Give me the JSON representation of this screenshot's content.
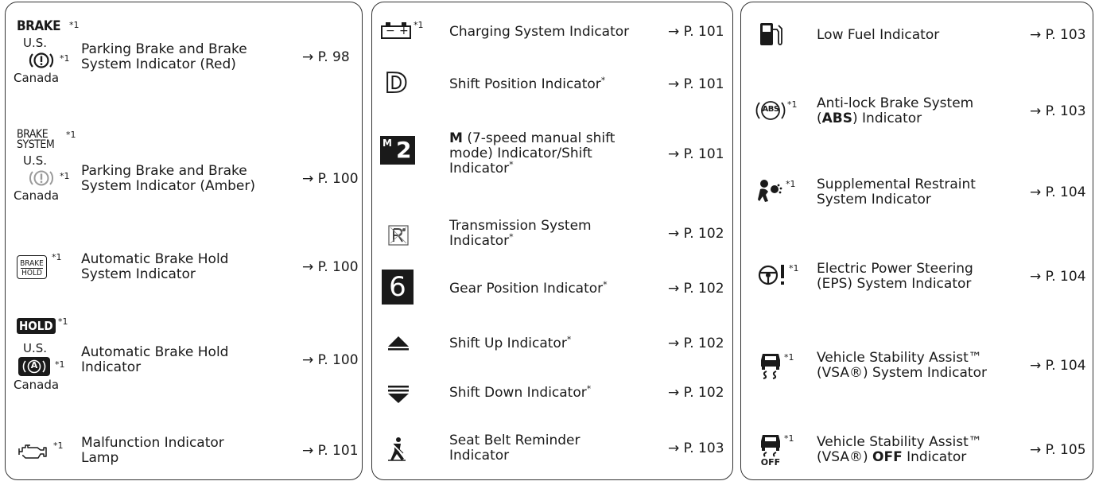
{
  "page": {
    "bg": "#ffffff",
    "border": "#333333",
    "ink": "#1a1a1a"
  },
  "col1": [
    {
      "icon_text": "BRAKE",
      "note": "*1",
      "region_us": "U.S.",
      "note2": "*1",
      "region_ca": "Canada",
      "label1": "Parking Brake and Brake",
      "label2": "System Indicator (Red)",
      "ref": "→ P. 98",
      "icon": "brake-warning-icon"
    },
    {
      "icon_text1": "BRAKE",
      "icon_text2": "SYSTEM",
      "note": "*1",
      "region_us": "U.S.",
      "note2": "*1",
      "region_ca": "Canada",
      "label1": "Parking Brake and Brake",
      "label2": "System Indicator (Amber)",
      "ref": "→ P. 100",
      "icon": "brake-system-warning-icon"
    },
    {
      "icon_text1": "BRAKE",
      "icon_text2": "HOLD",
      "note": "*1",
      "label1": "Automatic Brake Hold",
      "label2": "System Indicator",
      "ref": "→ P. 100",
      "icon": "brake-hold-system-icon"
    },
    {
      "icon_text": "HOLD",
      "note": "*1",
      "region_us": "U.S.",
      "note2": "*1",
      "region_ca": "Canada",
      "icon2_text": "A",
      "label1": "Automatic Brake Hold",
      "label2": "Indicator",
      "ref": "→ P. 100",
      "icon": "auto-brake-hold-icon"
    },
    {
      "note": "*1",
      "label1": "Malfunction Indicator",
      "label2": "Lamp",
      "ref": "→ P. 101",
      "icon": "engine-check-icon"
    }
  ],
  "col2": [
    {
      "note": "*1",
      "label1": "Charging System Indicator",
      "ref": "→ P. 101",
      "icon": "battery-icon",
      "minus": "−",
      "plus": "+"
    },
    {
      "icon_text": "D",
      "label1": "Shift Position Indicator",
      "star": "*",
      "ref": "→ P. 101",
      "icon": "shift-position-icon"
    },
    {
      "icon_text1": "M",
      "icon_text2": "2",
      "label_bold": "M",
      "label1": "(7-speed manual shift",
      "label2": "mode) Indicator/Shift",
      "label3": "Indicator",
      "star": "*",
      "ref": "→ P. 101",
      "icon": "manual-shift-icon"
    },
    {
      "label1": "Transmission System",
      "label2": "Indicator",
      "star": "*",
      "ref": "→ P. 102",
      "icon": "transmission-icon"
    },
    {
      "icon_text": "6",
      "label1": "Gear Position Indicator",
      "star": "*",
      "ref": "→ P. 102",
      "icon": "gear-position-icon"
    },
    {
      "label1": "Shift Up Indicator",
      "star": "*",
      "ref": "→ P. 102",
      "icon": "shift-up-icon"
    },
    {
      "label1": "Shift Down Indicator",
      "star": "*",
      "ref": "→ P. 102",
      "icon": "shift-down-icon"
    },
    {
      "label1": "Seat Belt Reminder",
      "label2": "Indicator",
      "ref": "→ P. 103",
      "icon": "seat-belt-icon"
    }
  ],
  "col3": [
    {
      "label1": "Low Fuel Indicator",
      "ref": "→ P. 103",
      "icon": "fuel-icon"
    },
    {
      "note": "*1",
      "icon_text": "ABS",
      "label1": "Anti-lock Brake System",
      "label2_bold": "ABS",
      "label2_rest": ") Indicator",
      "label2_open": "(",
      "ref": "→ P. 103",
      "icon": "abs-icon"
    },
    {
      "note": "*1",
      "label1": "Supplemental Restraint",
      "label2": "System Indicator",
      "ref": "→ P. 104",
      "icon": "airbag-icon"
    },
    {
      "note": "*1",
      "label1": "Electric Power Steering",
      "label2": "(EPS) System Indicator",
      "ref": "→ P. 104",
      "icon": "power-steering-icon"
    },
    {
      "note": "*1",
      "label1": "Vehicle Stability Assist™",
      "label2": "(VSA®) System Indicator",
      "ref": "→ P. 104",
      "icon": "vsa-icon"
    },
    {
      "note": "*1",
      "icon_text": "OFF",
      "label1": "Vehicle Stability Assist™",
      "label2_open": "(VSA®) ",
      "label2_bold": "OFF",
      "label2_rest": " Indicator",
      "ref": "→ P. 105",
      "icon": "vsa-off-icon"
    }
  ]
}
